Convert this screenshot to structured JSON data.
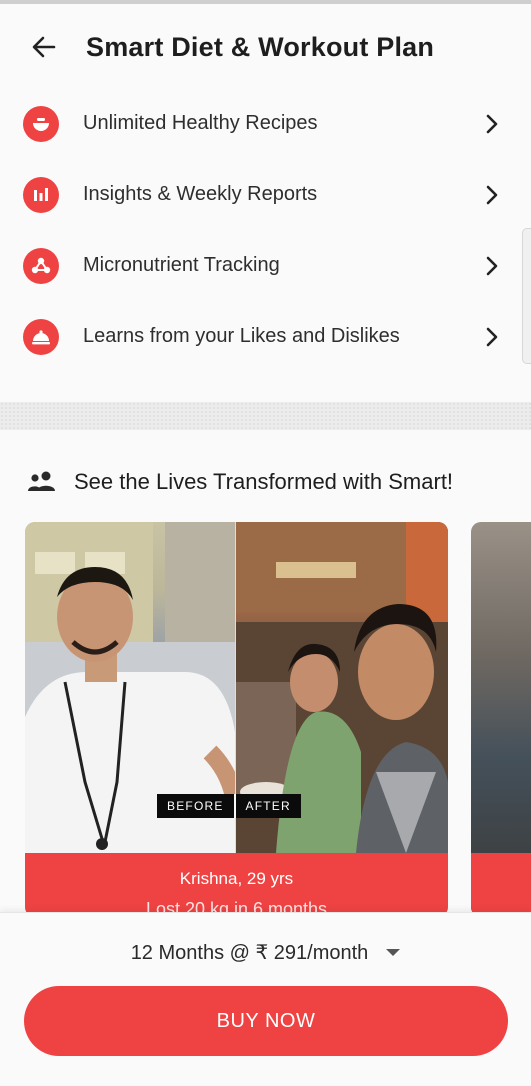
{
  "header": {
    "title": "Smart Diet & Workout Plan",
    "back_icon": "back-arrow-icon"
  },
  "features": [
    {
      "label": "Unlimited Healthy Recipes",
      "icon": "recipe-bowl-icon"
    },
    {
      "label": "Insights & Weekly Reports",
      "icon": "bar-chart-icon"
    },
    {
      "label": "Micronutrient Tracking",
      "icon": "nutrient-molecule-icon"
    },
    {
      "label": "Learns from your Likes and Dislikes",
      "icon": "food-cloche-icon"
    }
  ],
  "testimonials": {
    "section_title": "See the Lives Transformed with Smart!",
    "section_icon": "people-icon",
    "cards": [
      {
        "before_label": "BEFORE",
        "after_label": "AFTER",
        "name": "Krishna, 29 yrs",
        "result": "Lost 20 kg in 6 months"
      }
    ]
  },
  "purchase": {
    "plan_selected": "12 Months @ ₹ 291/month",
    "buy_label": "BUY NOW"
  },
  "colors": {
    "accent": "#ef4343",
    "text": "#222222",
    "background": "#fafafa"
  }
}
